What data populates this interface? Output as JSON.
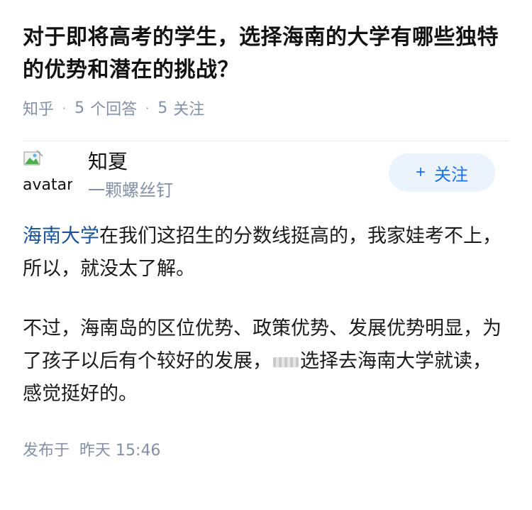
{
  "question": {
    "title": "对于即将高考的学生，选择海南的大学有哪些独特的优势和潜在的挑战？",
    "source": "知乎",
    "answers_count": "5",
    "answers_label": "个回答",
    "followers_count": "5",
    "followers_label": "关注"
  },
  "author": {
    "avatar_alt": "avatar",
    "name": "知夏",
    "bio": "一颗螺丝钉",
    "follow_plus": "+",
    "follow_label": "关注"
  },
  "answer": {
    "p1_link": "海南大学",
    "p1_text": "在我们这招生的分数线挺高的，我家娃考不上，所以，就没太了解。",
    "p2_text_a": "不过，海南岛的区位优势、政策优势、发展优势明显，为了孩子以后有个较好的发展，",
    "p2_text_b": "选择去海南大学就读，感觉挺好的。"
  },
  "footer": {
    "published_label": "发布于",
    "published_day": "昨天",
    "published_time": "15:46"
  }
}
